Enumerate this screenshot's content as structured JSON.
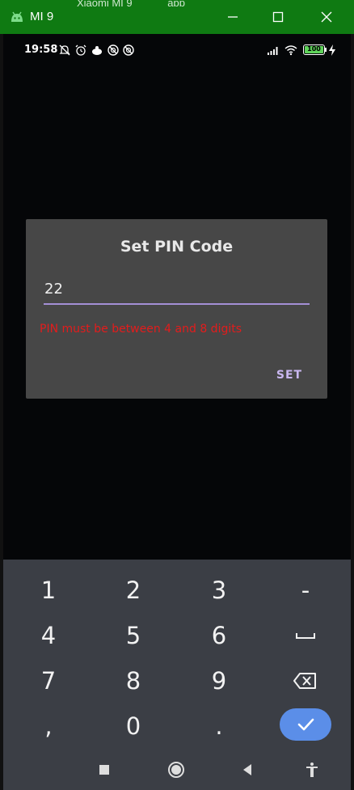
{
  "window": {
    "title": "MI 9",
    "behind_text": [
      "Xiaomi MI 9",
      "app"
    ]
  },
  "status_bar": {
    "time": "19:58",
    "battery_level": "100",
    "icons": [
      "notifications-off-icon",
      "alarm-icon",
      "app-notification-icon",
      "sync-icon",
      "sync-icon",
      "signal-icon",
      "wifi-icon",
      "battery-icon",
      "charging-icon"
    ]
  },
  "dialog": {
    "title": "Set PIN Code",
    "pin_value": "22",
    "error": "PIN must be between 4 and 8 digits",
    "set_label": "SET"
  },
  "keyboard": {
    "rows": [
      [
        "1",
        "2",
        "3",
        "-"
      ],
      [
        "4",
        "5",
        "6",
        "space-icon"
      ],
      [
        "7",
        "8",
        "9",
        "backspace-icon"
      ],
      [
        ",",
        "0",
        ".",
        "done-check-icon"
      ]
    ],
    "done_color": "#5b8ee8"
  },
  "nav_bar": {
    "buttons": [
      "recents-icon",
      "home-icon",
      "back-icon",
      "accessibility-icon"
    ]
  }
}
